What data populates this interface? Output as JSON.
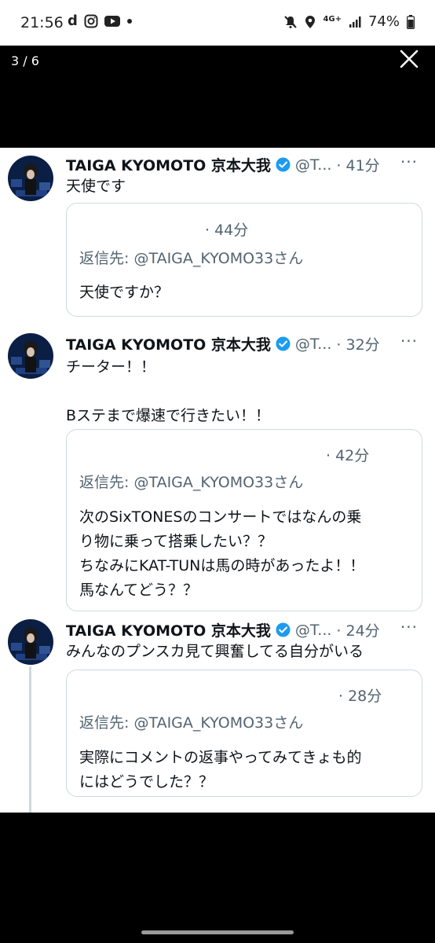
{
  "status_bar": {
    "time": "21:56",
    "app_letter": "d",
    "network": "4G+",
    "battery": "74%"
  },
  "viewer": {
    "counter": "3 / 6"
  },
  "tweets": [
    {
      "name": "TAIGA KYOMOTO 京本大我",
      "handle": "@T...",
      "time": "· 41分",
      "more": "···",
      "text": "天使です",
      "quote": {
        "time": "· 44分",
        "reply_to": "返信先: @TAIGA_KYOMO33さん",
        "text": "天使ですか？"
      }
    },
    {
      "name": "TAIGA KYOMOTO 京本大我",
      "handle": "@T...",
      "time": "· 32分",
      "more": "···",
      "text": "チーター！！\n\nBステまで爆速で行きたい！！",
      "quote": {
        "time": "· 42分",
        "reply_to": "返信先: @TAIGA_KYOMO33さん",
        "text": "次のSixTONESのコンサートではなんの乗\nり物に乗って搭乗したい？？\nちなみにKAT-TUNは馬の時があったよ！！\n馬なんてどう？？"
      }
    },
    {
      "name": "TAIGA KYOMOTO 京本大我",
      "handle": "@T...",
      "time": "· 24分",
      "more": "···",
      "text": "みんなのプンスカ見て興奮してる自分がいる",
      "quote": {
        "time": "· 28分",
        "reply_to": "返信先: @TAIGA_KYOMO33さん",
        "text": "実際にコメントの返事やってみてきょも的\nにはどうでした？？"
      }
    }
  ],
  "colors": {
    "verified_badge": "#1d9bf0",
    "secondary_text": "#536471",
    "border": "#cfd9de",
    "avatar_bg": "#0b1e44"
  },
  "icons": [
    "mute-icon",
    "location-icon",
    "signal-icon",
    "battery-icon",
    "close-icon",
    "verified-badge-icon",
    "more-icon"
  ]
}
